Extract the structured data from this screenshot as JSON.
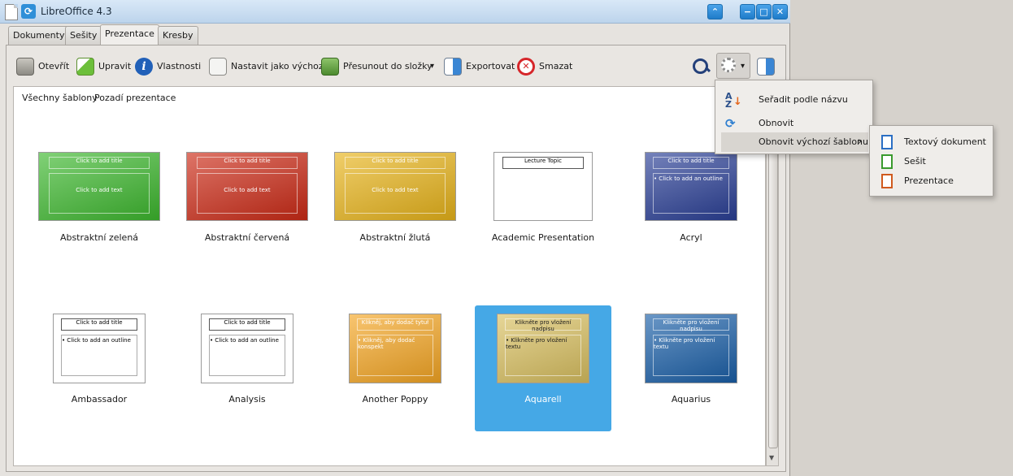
{
  "window": {
    "title": "LibreOffice 4.3",
    "menu_icon_glyph": "⟳",
    "controls": {
      "expand": "⌃",
      "minimize": "−",
      "maximize": "□",
      "close": "✕"
    }
  },
  "tabs": [
    {
      "label": "Dokumenty"
    },
    {
      "label": "Sešity"
    },
    {
      "label": "Prezentace"
    },
    {
      "label": "Kresby"
    }
  ],
  "toolbar": {
    "open": "Otevřít",
    "edit": "Upravit",
    "properties": "Vlastnosti",
    "set_default": "Nastavit jako výchozí",
    "move_to_folder": "Přesunout do složky",
    "export": "Exportovat",
    "delete": "Smazat",
    "dropdown_glyph": "▾",
    "search_icon": "search-icon",
    "settings_icon": "gear-icon",
    "import_icon": "import-icon"
  },
  "filters": {
    "all": "Všechny šablony",
    "backgrounds": "Pozadí prezentace"
  },
  "templates": [
    {
      "name": "Abstraktní zelená",
      "title_ph": "Click to add title",
      "text_ph": "Click to add text",
      "color": "#3db82e"
    },
    {
      "name": "Abstraktní červená",
      "title_ph": "Click to add title",
      "text_ph": "Click to add text",
      "color": "#cc2a16"
    },
    {
      "name": "Abstraktní žlutá",
      "title_ph": "Click to add title",
      "text_ph": "Click to add text",
      "color": "#e8b41a"
    },
    {
      "name": "Academic Presentation",
      "title_ph": "Lecture Topic",
      "text_ph": "",
      "color": "#ffffff"
    },
    {
      "name": "Acryl",
      "title_ph": "Click to add title",
      "text_ph": "• Click to add an outline",
      "color": "#2a3f96"
    },
    {
      "name": "Ambassador",
      "title_ph": "Click to add title",
      "text_ph": "• Click to add an outline",
      "color": "#ffffff"
    },
    {
      "name": "Analysis",
      "title_ph": "Click to add title",
      "text_ph": "• Click to add an outline",
      "color": "#ffffff"
    },
    {
      "name": "Another Poppy",
      "title_ph": "Klikněj, aby dodač tytuł",
      "text_ph": "• Klikněj, aby dodač konspekt",
      "color": "#f5a623"
    },
    {
      "name": "Aquarell",
      "title_ph": "Klikněte pro vložení nadpisu",
      "text_ph": "• Klikněte pro vložení textu",
      "color": "#d9c060",
      "selected": true
    },
    {
      "name": "Aquarius",
      "title_ph": "Klikněte pro vložení nadpisu",
      "text_ph": "• Klikněte pro vložení textu",
      "color": "#1a5fa8"
    }
  ],
  "settings_menu": {
    "sort": "Seřadit podle názvu",
    "refresh": "Obnovit",
    "reset_default": "Obnovit výchozí šablonu",
    "submenu_arrow": "›"
  },
  "reset_submenu": {
    "text_doc": "Textový dokument",
    "spreadsheet": "Sešit",
    "presentation": "Prezentace"
  },
  "scrollbar": {
    "up": "▲",
    "down": "▼"
  }
}
